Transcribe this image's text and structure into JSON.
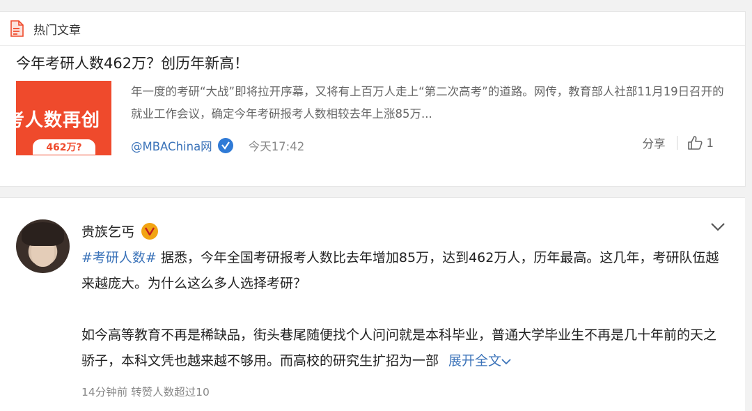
{
  "section": {
    "title": "热门文章"
  },
  "article": {
    "title": "今年考研人数462万？创历年新高！",
    "thumbnail_text": "考人数再创",
    "thumbnail_badge": "462万?",
    "summary": "年一度的考研“大战”即将拉开序幕，又将有上百万人走上“第二次高考”的道路。网传，教育部人社部11月19日召开的就业工作会议，确定今年考研报考人数相较去年上涨85万...",
    "source": "@MBAChina网",
    "time": "今天17:42",
    "share_label": "分享",
    "like_count": "1"
  },
  "post": {
    "username": "贵族乞丐",
    "hashtag": "#考研人数#",
    "text1": "据悉，今年全国考研报考人数比去年增加85万，达到462万人，历年最高。这几年，考研队伍越来越庞大。为什么这么多人选择考研？",
    "text2": "如今高等教育不再是稀缺品，街头巷尾随便找个人问问就是本科毕业，普通大学毕业生不再是几十年前的天之骄子，本科文凭也越来越不够用。而高校的研究生扩招为一部",
    "expand_label": "展开全文",
    "meta": "14分钟前 转赞人数超过10"
  },
  "colors": {
    "link": "#3b73b9",
    "accent_red": "#ef4a2c",
    "verified_blue": "#2f7ad6",
    "vip_orange": "#f2a413"
  },
  "icons": [
    "document-icon",
    "verified-icon",
    "thumbs-up-icon",
    "vip-badge-icon",
    "chevron-down-icon"
  ]
}
